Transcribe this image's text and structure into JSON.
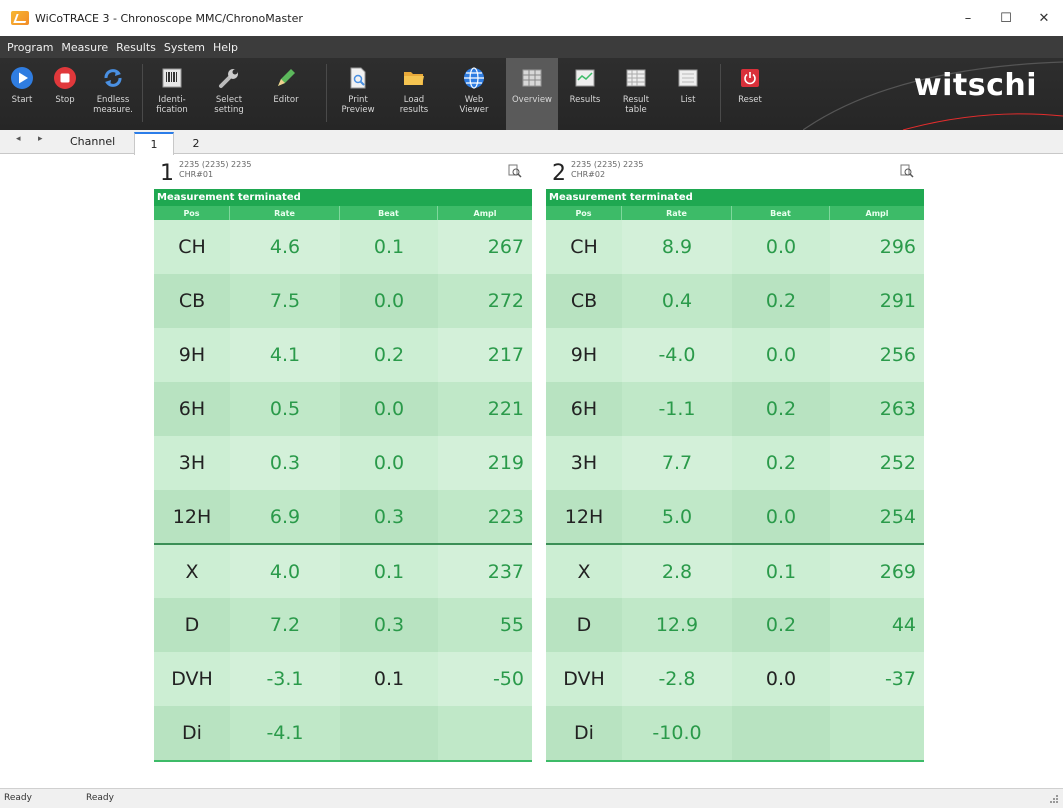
{
  "window": {
    "title": "WiCoTRACE 3 - Chronoscope MMC/ChronoMaster",
    "minimize": "–",
    "maximize": "☐",
    "close": "✕"
  },
  "menu": [
    "Program",
    "Measure",
    "Results",
    "System",
    "Help"
  ],
  "toolbar": {
    "buttons": [
      {
        "label": "Start",
        "icon": "play-icon"
      },
      {
        "label": "Stop",
        "icon": "stop-icon"
      },
      {
        "label": "Endless\nmeasure.",
        "icon": "loop-icon"
      },
      {
        "label": "Identi-\nfication",
        "icon": "barcode-icon"
      },
      {
        "label": "Select\nsetting",
        "icon": "wrench-icon"
      },
      {
        "label": "Editor",
        "icon": "pencil-icon"
      },
      {
        "label": "Print\nPreview",
        "icon": "print-preview-icon"
      },
      {
        "label": "Load\nresults",
        "icon": "folder-icon"
      },
      {
        "label": "Web\nViewer",
        "icon": "globe-icon"
      },
      {
        "label": "Overview",
        "icon": "grid-icon"
      },
      {
        "label": "Results",
        "icon": "chart-icon"
      },
      {
        "label": "Result\ntable",
        "icon": "table-icon"
      },
      {
        "label": "List",
        "icon": "list-icon"
      },
      {
        "label": "Reset",
        "icon": "power-icon"
      }
    ],
    "brand": "witschi"
  },
  "tabs": {
    "nav_prev": "◂",
    "nav_next": "▸",
    "channel_label": "Channel",
    "items": [
      "1",
      "2"
    ],
    "active": "1"
  },
  "panels": [
    {
      "number": "1",
      "info1": "2235 (2235) 2235",
      "info2": "CHR#01",
      "status": "Measurement terminated",
      "headers": [
        "Pos",
        "Rate",
        "Beat",
        "Ampl"
      ],
      "rows": [
        {
          "pos": "CH",
          "rate": "4.6",
          "beat": "0.1",
          "ampl": "267"
        },
        {
          "pos": "CB",
          "rate": "7.5",
          "beat": "0.0",
          "ampl": "272"
        },
        {
          "pos": "9H",
          "rate": "4.1",
          "beat": "0.2",
          "ampl": "217"
        },
        {
          "pos": "6H",
          "rate": "0.5",
          "beat": "0.0",
          "ampl": "221"
        },
        {
          "pos": "3H",
          "rate": "0.3",
          "beat": "0.0",
          "ampl": "219"
        },
        {
          "pos": "12H",
          "rate": "6.9",
          "beat": "0.3",
          "ampl": "223"
        },
        {
          "pos": "X",
          "rate": "4.0",
          "beat": "0.1",
          "ampl": "237"
        },
        {
          "pos": "D",
          "rate": "7.2",
          "beat": "0.3",
          "ampl": "55"
        },
        {
          "pos": "DVH",
          "rate": "-3.1",
          "beat": "0.1",
          "ampl": "-50"
        },
        {
          "pos": "Di",
          "rate": "-4.1",
          "beat": "",
          "ampl": ""
        }
      ]
    },
    {
      "number": "2",
      "info1": "2235 (2235) 2235",
      "info2": "CHR#02",
      "status": "Measurement terminated",
      "headers": [
        "Pos",
        "Rate",
        "Beat",
        "Ampl"
      ],
      "rows": [
        {
          "pos": "CH",
          "rate": "8.9",
          "beat": "0.0",
          "ampl": "296"
        },
        {
          "pos": "CB",
          "rate": "0.4",
          "beat": "0.2",
          "ampl": "291"
        },
        {
          "pos": "9H",
          "rate": "-4.0",
          "beat": "0.0",
          "ampl": "256"
        },
        {
          "pos": "6H",
          "rate": "-1.1",
          "beat": "0.2",
          "ampl": "263"
        },
        {
          "pos": "3H",
          "rate": "7.7",
          "beat": "0.2",
          "ampl": "252"
        },
        {
          "pos": "12H",
          "rate": "5.0",
          "beat": "0.0",
          "ampl": "254"
        },
        {
          "pos": "X",
          "rate": "2.8",
          "beat": "0.1",
          "ampl": "269"
        },
        {
          "pos": "D",
          "rate": "12.9",
          "beat": "0.2",
          "ampl": "44"
        },
        {
          "pos": "DVH",
          "rate": "-2.8",
          "beat": "0.0",
          "ampl": "-37"
        },
        {
          "pos": "Di",
          "rate": "-10.0",
          "beat": "",
          "ampl": ""
        }
      ]
    }
  ],
  "statusbar": {
    "left": "Ready",
    "right": "Ready"
  },
  "colors": {
    "status_green": "#1fa851",
    "value_green": "#2a9a4a",
    "row_light": "#d3f0d9",
    "row_dark": "#c0e8c8"
  }
}
